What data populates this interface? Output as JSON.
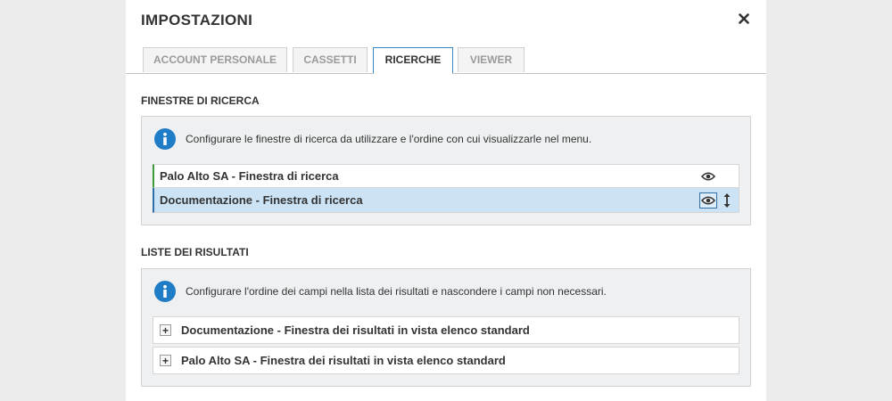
{
  "dialog": {
    "title": "IMPOSTAZIONI",
    "close_symbol": "✕"
  },
  "tabs": [
    {
      "label": "ACCOUNT PERSONALE",
      "active": false
    },
    {
      "label": "CASSETTI",
      "active": false
    },
    {
      "label": "RICERCHE",
      "active": true
    },
    {
      "label": "VIEWER",
      "active": false
    }
  ],
  "search_windows": {
    "section_title": "FINESTRE DI RICERCA",
    "info_text": "Configurare le finestre di ricerca da utilizzare e l'ordine con cui visualizzarle nel menu.",
    "items": [
      {
        "label": "Palo Alto SA - Finestra di ricerca",
        "selected": false
      },
      {
        "label": "Documentazione - Finestra di ricerca",
        "selected": true
      }
    ]
  },
  "result_lists": {
    "section_title": "LISTE DEI RISULTATI",
    "info_text": "Configurare l'ordine dei campi nella lista dei risultati e nascondere i campi non necessari.",
    "expand_symbol": "+",
    "items": [
      {
        "label": "Documentazione - Finestra dei risultati in vista elenco standard"
      },
      {
        "label": "Palo Alto SA - Finestra dei risultati in vista elenco standard"
      }
    ]
  },
  "colors": {
    "accent_blue": "#1f7cc6",
    "selected_row": "#cbe3f5",
    "green_marker": "#3e9a3a",
    "panel_bg": "#eef0f1",
    "page_bg": "#ececec"
  },
  "icons": [
    "close-icon",
    "info-icon",
    "eye-icon",
    "move-vertical-icon",
    "plus-icon"
  ]
}
